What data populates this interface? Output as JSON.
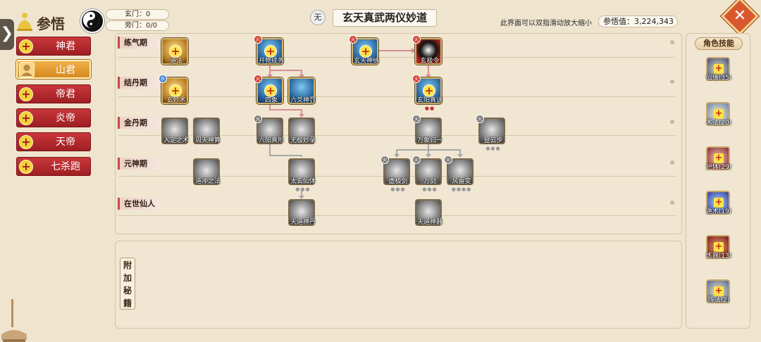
{
  "header": {
    "title": "参悟",
    "stats": [
      {
        "label": "玄门",
        "value": "0"
      },
      {
        "label": "旁门",
        "value": "0/0"
      }
    ],
    "element_badge": "无",
    "tree_title": "玄天真武两仪妙道",
    "hint": "此界面可以双指滑动放大缩小",
    "score_label": "参悟值：",
    "score_value": "3,224,343",
    "close_icon": "close-icon"
  },
  "sidebar": {
    "tab_glyph": "❯",
    "items": [
      {
        "label": "神君",
        "icon": "plus-icon",
        "selected": false
      },
      {
        "label": "山君",
        "icon": "avatar",
        "selected": true
      },
      {
        "label": "帝君",
        "icon": "plus-icon",
        "selected": false
      },
      {
        "label": "炎帝",
        "icon": "plus-icon",
        "selected": false
      },
      {
        "label": "天帝",
        "icon": "plus-icon",
        "selected": false
      },
      {
        "label": "七杀跑",
        "icon": "plus-icon",
        "selected": false
      }
    ]
  },
  "tree": {
    "stages": [
      "练气期",
      "结丹期",
      "金丹期",
      "元神期",
      "在世仙人"
    ],
    "nodes": [
      {
        "label": "道法",
        "element": "",
        "state": "active",
        "style": "gold",
        "unlockable": true,
        "pips": 0
      },
      {
        "label": "开物成务",
        "element": "火",
        "state": "active",
        "style": "blue",
        "unlockable": true,
        "pips": 0
      },
      {
        "label": "玄天神纳",
        "element": "火",
        "state": "active",
        "style": "blue",
        "unlockable": true,
        "pips": 0
      },
      {
        "label": "玄极令",
        "element": "火",
        "state": "active",
        "style": "dark",
        "unlockable": false,
        "pips": 0
      },
      {
        "label": "玄妙术",
        "element": "水",
        "state": "active",
        "style": "gold",
        "unlockable": true,
        "pips": 0
      },
      {
        "label": "四象",
        "element": "火",
        "state": "active",
        "style": "blue",
        "unlockable": true,
        "pips": 0
      },
      {
        "label": "六爻神罚",
        "element": "",
        "state": "active",
        "style": "blue",
        "unlockable": false,
        "pips": 0
      },
      {
        "label": "玄阳真诀",
        "element": "火",
        "state": "active",
        "style": "blue",
        "unlockable": true,
        "pips": 2
      },
      {
        "label": "入定之术",
        "element": "",
        "state": "locked",
        "style": "grey",
        "unlockable": false,
        "pips": 0
      },
      {
        "label": "周天神算",
        "element": "",
        "state": "locked",
        "style": "grey",
        "unlockable": false,
        "pips": 0
      },
      {
        "label": "六阳真形",
        "element": "火",
        "state": "locked",
        "style": "grey",
        "unlockable": false,
        "pips": 0
      },
      {
        "label": "无极妙录",
        "element": "",
        "state": "locked",
        "style": "grey",
        "unlockable": false,
        "pips": 0
      },
      {
        "label": "万象归一",
        "element": "火",
        "state": "locked",
        "style": "grey",
        "unlockable": false,
        "pips": 0
      },
      {
        "label": "登云步",
        "element": "火",
        "state": "locked",
        "style": "grey",
        "unlockable": false,
        "pips": 3
      },
      {
        "label": "道冲之法",
        "element": "",
        "state": "locked",
        "style": "grey",
        "unlockable": false,
        "pips": 0
      },
      {
        "label": "太玄仙体",
        "element": "",
        "state": "locked",
        "style": "grey",
        "unlockable": false,
        "pips": 3
      },
      {
        "label": "虚极剑",
        "element": "火",
        "state": "locked",
        "style": "grey",
        "unlockable": false,
        "pips": 3
      },
      {
        "label": "万剑",
        "element": "火",
        "state": "locked",
        "style": "grey",
        "unlockable": false,
        "pips": 3
      },
      {
        "label": "风雷变",
        "element": "火",
        "state": "locked",
        "style": "grey",
        "unlockable": false,
        "pips": 4
      },
      {
        "label": "天道神丹",
        "element": "",
        "state": "locked",
        "style": "grey",
        "unlockable": false,
        "pips": 0
      },
      {
        "label": "天道神器",
        "element": "",
        "state": "locked",
        "style": "grey",
        "unlockable": false,
        "pips": 0
      }
    ]
  },
  "skills": {
    "title": "角色技能",
    "items": [
      {
        "label": "仙缘(35)",
        "color": "#3c4a8a"
      },
      {
        "label": "术法(20)",
        "color": "#6a82b8"
      },
      {
        "label": "护体(29)",
        "color": "#8a2a3a"
      },
      {
        "label": "遁术(19)",
        "color": "#3a3a9a"
      },
      {
        "label": "炼器(13)",
        "color": "#7a1a1a"
      },
      {
        "label": "阵法(2)",
        "color": "#4a6aa8"
      }
    ]
  },
  "extra": {
    "tab_label": "附加秘籍"
  }
}
